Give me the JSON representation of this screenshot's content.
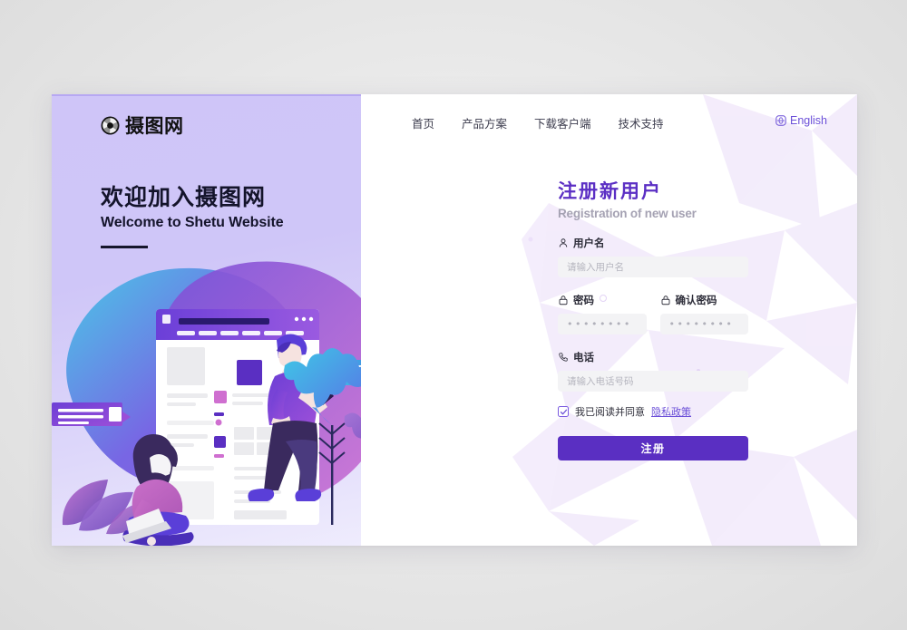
{
  "brand": {
    "name": "摄图网",
    "logo_icon": "camera-aperture-icon"
  },
  "hero": {
    "heading_cn": "欢迎加入摄图网",
    "heading_en": "Welcome to Shetu Website"
  },
  "nav": {
    "items": [
      {
        "label": "首页"
      },
      {
        "label": "产品方案"
      },
      {
        "label": "下载客户端"
      },
      {
        "label": "技术支持"
      }
    ],
    "language": {
      "label": "English",
      "icon": "globe-language-icon"
    }
  },
  "form": {
    "title_cn": "注册新用户",
    "title_en": "Registration of new user",
    "fields": {
      "username": {
        "label": "用户名",
        "placeholder": "请输入用户名",
        "value": "",
        "icon": "user-icon"
      },
      "password": {
        "label": "密码",
        "value": "••••••••",
        "icon": "lock-icon"
      },
      "confirm_password": {
        "label": "确认密码",
        "value": "••••••••",
        "icon": "lock-icon"
      },
      "phone": {
        "label": "电话",
        "placeholder": "请输入电话号码",
        "value": "",
        "icon": "phone-icon"
      }
    },
    "agreement": {
      "checked": true,
      "text": "我已阅读并同意",
      "link_label": "隐私政策"
    },
    "submit_label": "注册"
  },
  "colors": {
    "accent_purple": "#5a2fc2",
    "link_purple": "#6b4fd8",
    "title_purple": "#5b2fc4",
    "panel_light": "#cfc5f8",
    "input_bg": "#f3f3f5",
    "heading_dark": "#14142b",
    "subtitle_gray": "#a5a2b3"
  }
}
